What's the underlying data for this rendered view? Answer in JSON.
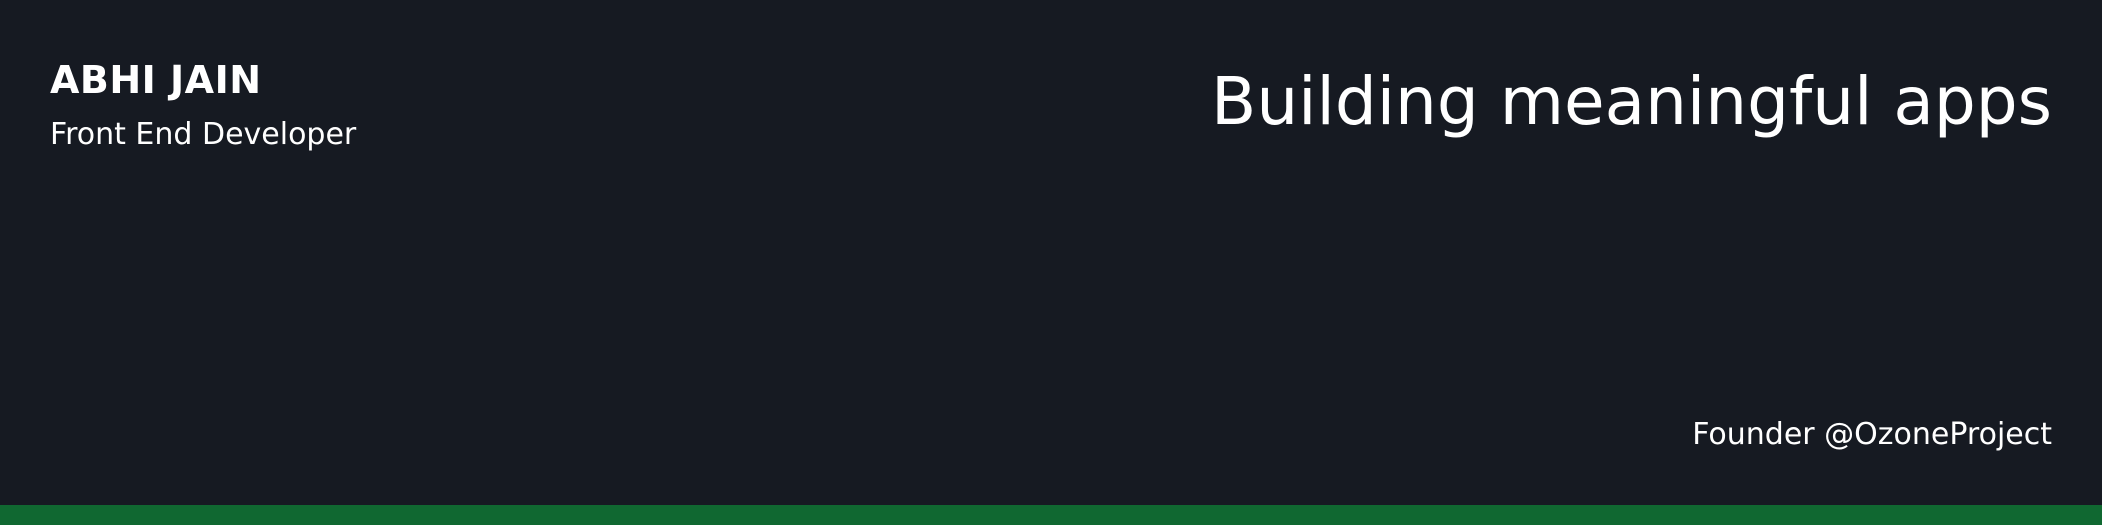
{
  "profile": {
    "name": "ABHI JAIN",
    "role": "Front End Developer"
  },
  "tagline": "Building meaningful apps",
  "founder_text": "Founder @OzoneProject",
  "colors": {
    "background": "#161a22",
    "text": "#ffffff",
    "accent_bar": "#106831"
  }
}
